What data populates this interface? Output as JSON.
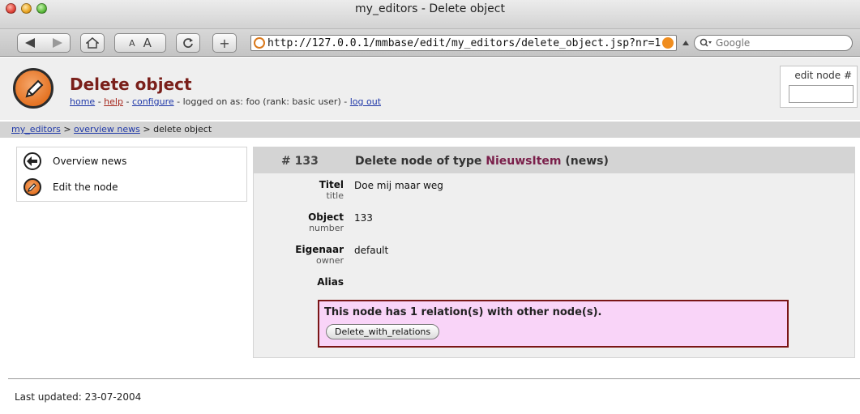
{
  "window": {
    "title": "my_editors - Delete object"
  },
  "toolbar": {
    "url": "http://127.0.0.1/mmbase/edit/my_editors/delete_object.jsp?nr=1:",
    "search_placeholder": "Google",
    "text_smaller": "A",
    "text_larger": "A",
    "add": "+"
  },
  "header": {
    "title": "Delete object",
    "home": "home",
    "help": "help",
    "configure": "configure",
    "logged_text": "logged on as: foo (rank: basic user)",
    "logout": "log out",
    "edit_node_label": "edit node #"
  },
  "breadcrumb": {
    "root": "my_editors",
    "parent": "overview news",
    "current": "delete object"
  },
  "sidebar": {
    "items": [
      {
        "label": "Overview news",
        "icon": "back-arrow-icon"
      },
      {
        "label": "Edit the node",
        "icon": "pencil-icon"
      }
    ]
  },
  "main": {
    "node_number": "# 133",
    "title_prefix": "Delete node of type",
    "type_name": "NieuwsItem",
    "type_suffix": "(news)",
    "fields": [
      {
        "name": "Titel",
        "sub": "title",
        "value": "Doe mij maar weg"
      },
      {
        "name": "Object",
        "sub": "number",
        "value": "133"
      },
      {
        "name": "Eigenaar",
        "sub": "owner",
        "value": "default"
      },
      {
        "name": "Alias",
        "sub": "",
        "value": ""
      }
    ],
    "relation_message": "This node has 1 relation(s) with other node(s).",
    "delete_button": "Delete_with_relations"
  },
  "footer": {
    "last_updated": "Last updated: 23-07-2004"
  },
  "colors": {
    "title": "#7a1f1a",
    "type": "#7a1f4a",
    "relation_bg": "#f9d4f8",
    "relation_border": "#7a1616"
  }
}
